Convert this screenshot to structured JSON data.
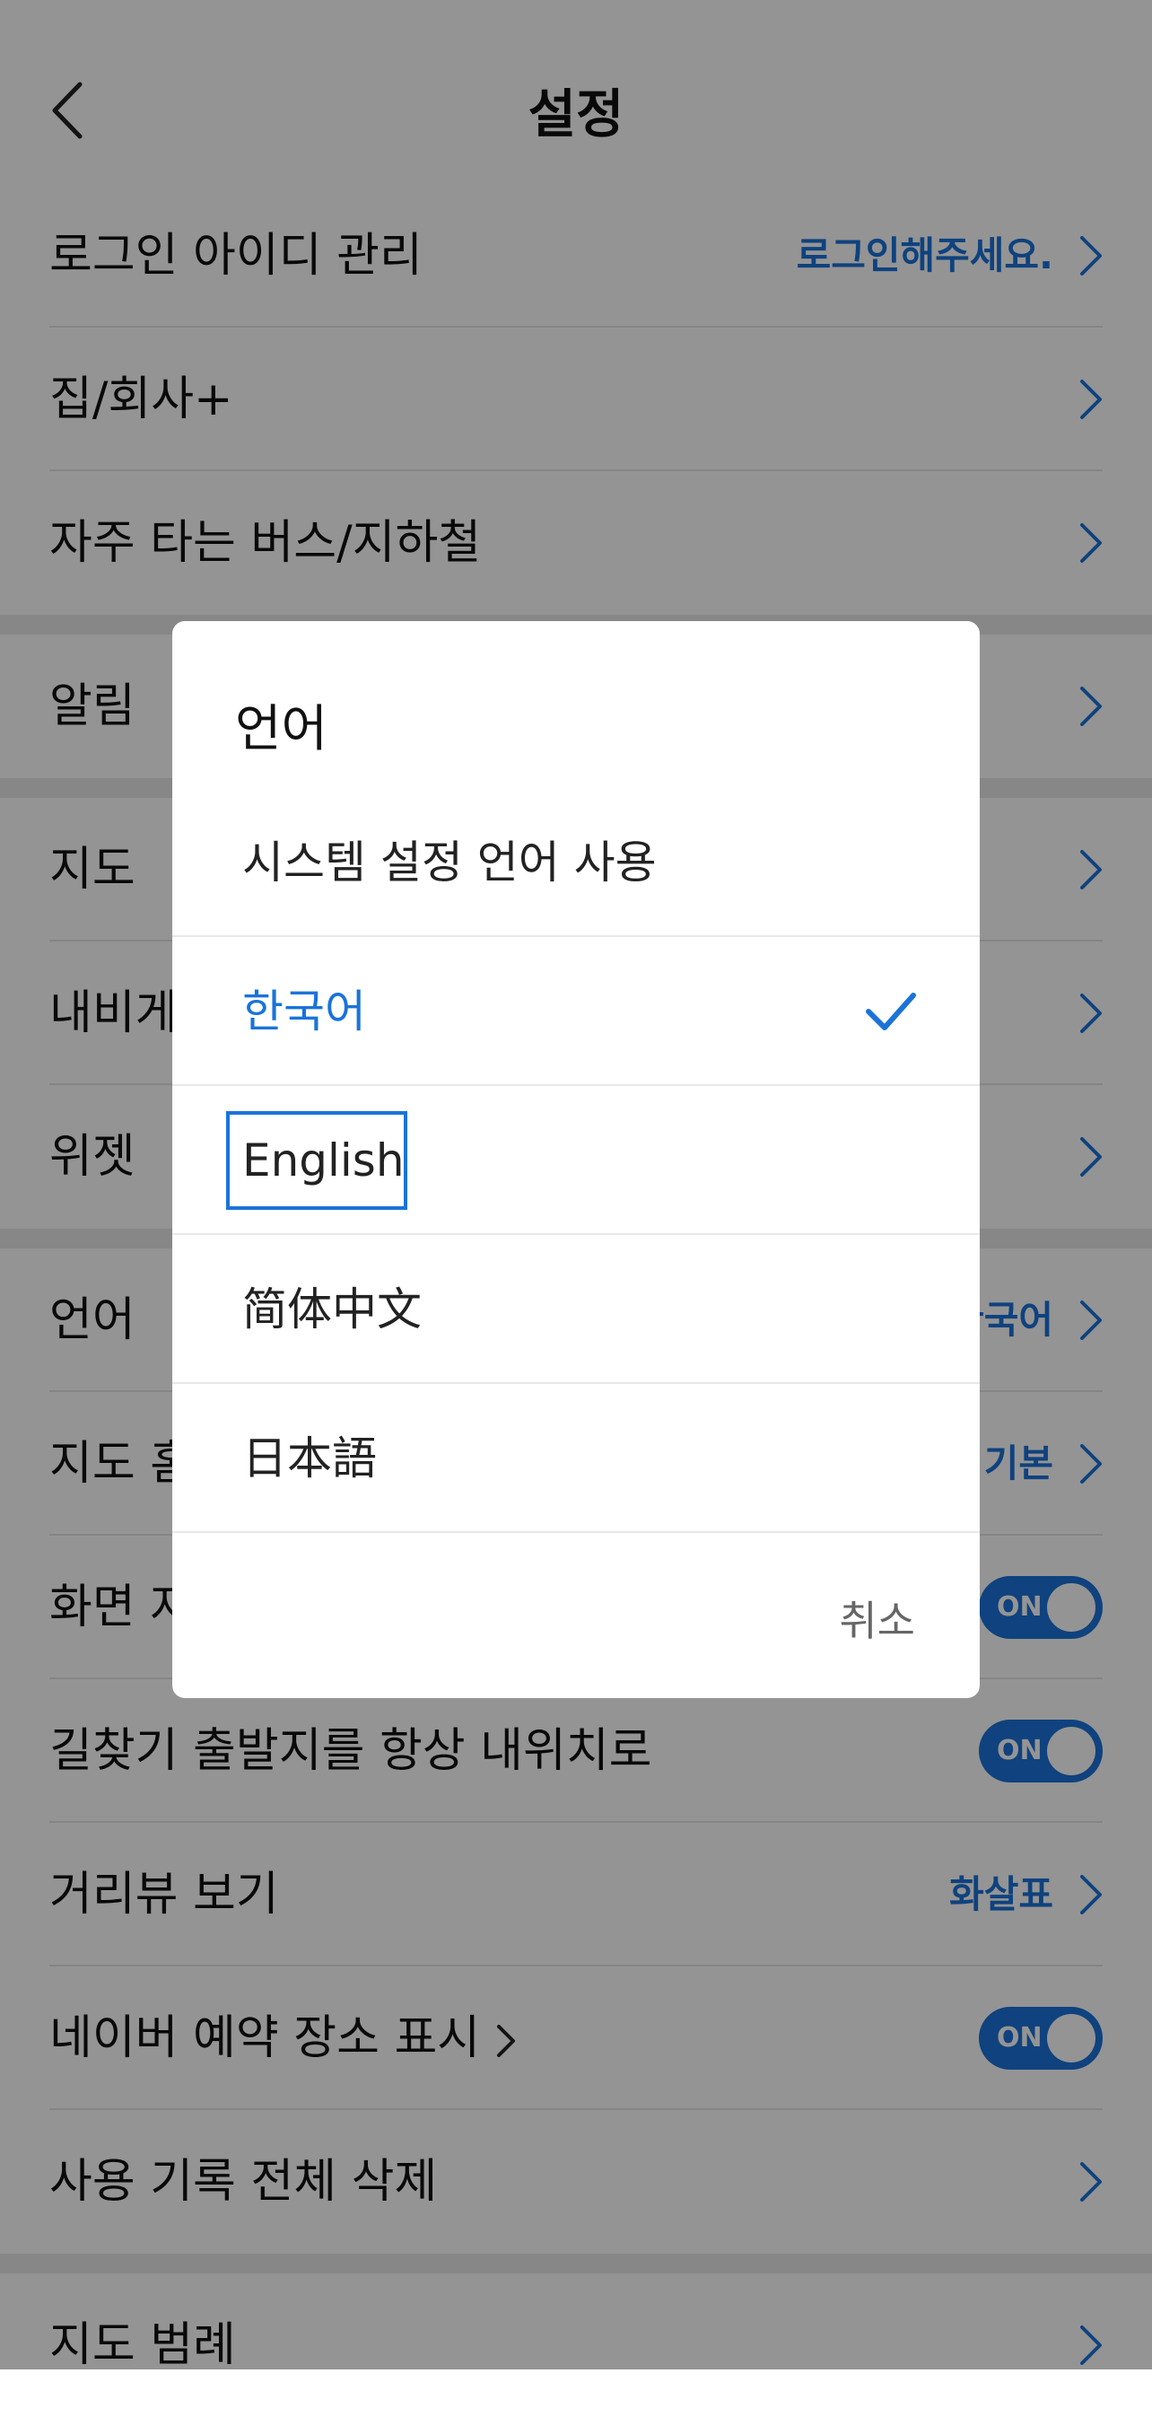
{
  "header": {
    "title": "설정",
    "back_icon": "chevron-left-icon"
  },
  "settings": {
    "login_label": "로그인 아이디 관리",
    "login_value": "로그인해주세요.",
    "home_label": "집/회사+",
    "frequent_label": "자주 타는 버스/지하철",
    "alarm_label": "알림",
    "map_label": "지도",
    "navi_label": "내비게이션",
    "widget_label": "위젯",
    "language_label": "언어",
    "language_value": "한국어",
    "maphome_label": "지도 홈",
    "maphome_value": "기본",
    "screen_label": "화면 자동 꺼짐 방지",
    "screen_toggle": "ON",
    "route_label": "길찾기 출발지를 항상 내위치로",
    "route_toggle": "ON",
    "street_label": "거리뷰 보기",
    "street_value": "화살표",
    "reserve_label": "네이버 예약 장소 표시",
    "reserve_toggle": "ON",
    "history_label": "사용 기록 전체 삭제",
    "legend_label": "지도 범례"
  },
  "dialog": {
    "title": "언어",
    "options": [
      {
        "label": "시스템 설정 언어 사용"
      },
      {
        "label": "한국어",
        "selected": true
      },
      {
        "label": "English",
        "focused": true
      },
      {
        "label": "简体中文"
      },
      {
        "label": "日本語"
      }
    ],
    "cancel_label": "취소"
  },
  "colors": {
    "accent": "#1a73d9",
    "overlay": "rgba(0,0,0,0.42)"
  }
}
